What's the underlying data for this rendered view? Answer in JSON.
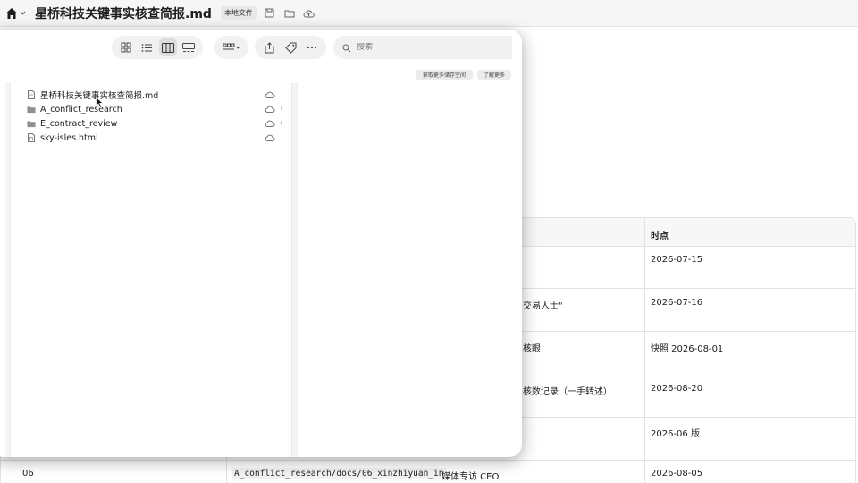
{
  "topbar": {
    "title": "星桥科技关键事实核查简报.md",
    "badge": "本地文件"
  },
  "table": {
    "header": {
      "time": "时点"
    },
    "rows": [
      {
        "frag": "",
        "time": "2026-07-15"
      },
      {
        "frag": "交易人士\"",
        "time": "2026-07-16"
      },
      {
        "frag": "核眼",
        "time": "快照 2026-08-01"
      },
      {
        "frag": "核数记录（一手转述）",
        "time": "2026-08-20"
      },
      {
        "frag": "",
        "time": "2026-06 版"
      },
      {
        "id": "06",
        "path": "A_conflict_research/docs/06_xinzhiyuan_in",
        "source": "媒体专访 CEO",
        "time": "2026-08-05"
      }
    ]
  },
  "finder": {
    "search_placeholder": "搜索",
    "pill_left": "获取更多储存空间",
    "pill_right": "了解更多",
    "files": [
      {
        "name": "星桥科技关键事实核查简报.md",
        "kind": "document",
        "has_chevron": false
      },
      {
        "name": "A_conflict_research",
        "kind": "folder",
        "has_chevron": true
      },
      {
        "name": "E_contract_review",
        "kind": "folder",
        "has_chevron": true
      },
      {
        "name": "sky-isles.html",
        "kind": "html",
        "has_chevron": false
      }
    ]
  },
  "colors": {
    "accent": "#1d1d1f",
    "toolbar_bg": "#f6f6f7",
    "folder": "#8e8e93"
  }
}
